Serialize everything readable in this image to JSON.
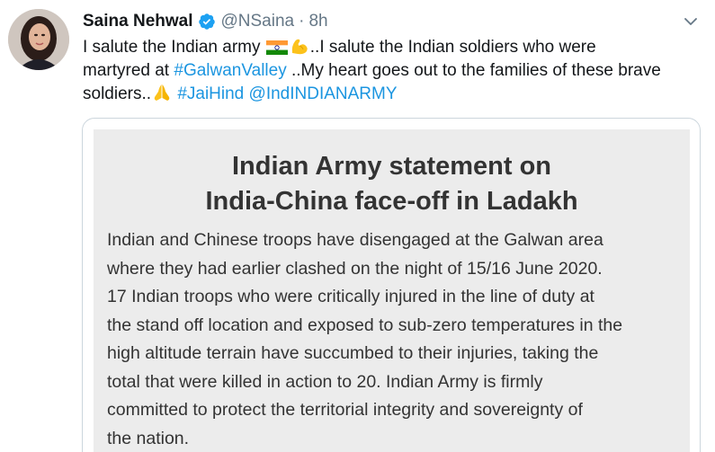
{
  "author": {
    "display_name": "Saina Nehwal",
    "handle": "@NSaina",
    "separator": "·",
    "time": "8h",
    "verified": true
  },
  "tweet": {
    "line1_a": "I salute the Indian army ",
    "line1_b": "..I salute the Indian soldiers who were",
    "line2_a": "martyred at ",
    "line2_hashtag": "#GalwanValley",
    "line2_b": " ..My heart goes out to the families of these brave",
    "line3_a": "soldiers..",
    "line3_hashtag": "#JaiHind",
    "line3_mention": "@IndINDIANARMY",
    "emojis": [
      "india-flag-icon",
      "flexed-biceps-icon",
      "folded-hands-icon"
    ]
  },
  "statement": {
    "title_line1": "Indian Army statement on",
    "title_line2": "India-China face-off in Ladakh",
    "body_lines": [
      "Indian and Chinese troops have disengaged at the Galwan area",
      "where they had earlier clashed on the night of 15/16 June 2020.",
      "17 Indian troops who were critically injured in the line of duty at",
      "the stand off location and exposed to sub-zero temperatures in the",
      "high altitude terrain have succumbed to their injuries, taking the",
      "total that were killed in action to 20. Indian Army is firmly",
      "committed to protect the territorial integrity and sovereignty of",
      "the nation."
    ]
  },
  "colors": {
    "link": "#1b95e0",
    "verified": "#1da1f2",
    "muted": "#657786",
    "text": "#14171a",
    "statement_bg": "#ececec",
    "statement_text": "#333333"
  }
}
